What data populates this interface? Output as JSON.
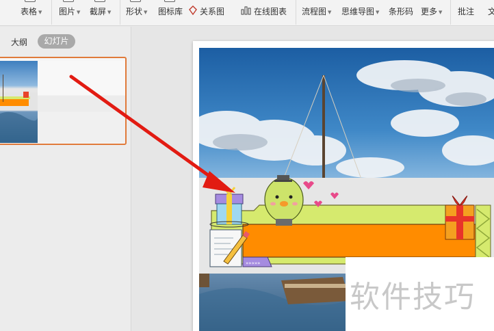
{
  "toolbar": {
    "items": [
      {
        "label": "表格",
        "dropdown": true
      },
      {
        "label": "图片",
        "dropdown": true
      },
      {
        "label": "截屏",
        "dropdown": true
      },
      {
        "label": "形状",
        "dropdown": true
      },
      {
        "label": "图标库",
        "dropdown": false
      },
      {
        "label": "关系图",
        "dropdown": false
      },
      {
        "label": "在线图表",
        "dropdown": false
      },
      {
        "label": "流程图",
        "dropdown": true
      },
      {
        "label": "思维导图",
        "dropdown": true
      },
      {
        "label": "条形码",
        "dropdown": false
      },
      {
        "label": "更多",
        "dropdown": true
      },
      {
        "label": "批注",
        "dropdown": false
      },
      {
        "label": "文",
        "dropdown": false
      }
    ]
  },
  "left_panel": {
    "tabs": [
      {
        "label": "大纲",
        "active": false
      },
      {
        "label": "幻灯片",
        "active": true
      }
    ],
    "selected_slide": 1
  },
  "watermark": {
    "text": "软件技巧"
  },
  "colors": {
    "accent_orange": "#e07a3a",
    "banner_orange": "#ff8c00",
    "banner_green": "#d6ea6e",
    "arrow_red": "#e21b12",
    "gift_purple": "#a58be0"
  },
  "icons": [
    "table-icon",
    "picture-icon",
    "screenshot-icon",
    "shape-icon",
    "icon-library-icon",
    "relation-diagram-icon",
    "online-chart-icon",
    "flowchart-icon",
    "mindmap-icon",
    "barcode-icon",
    "more-icon",
    "comment-icon"
  ]
}
